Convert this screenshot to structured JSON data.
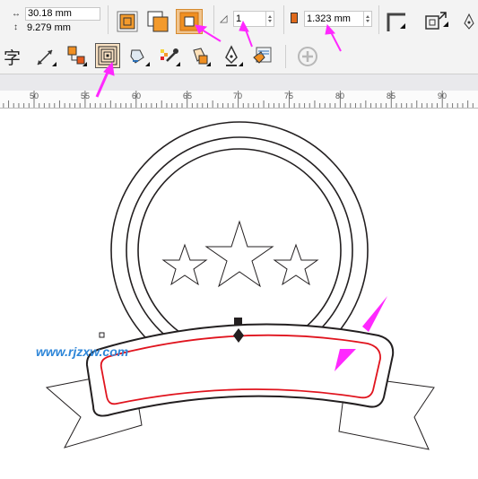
{
  "property_bar": {
    "width_value": "30.18 mm",
    "height_value": "9.279 mm",
    "steps_value": "1",
    "offset_value": "1.323 mm",
    "contour_modes": [
      "contour-to-center",
      "inside-contour",
      "outside-contour"
    ],
    "active_mode": "outside-contour"
  },
  "toolbox": {
    "tools": [
      "text-tool-icon",
      "dimension-tool-icon",
      "connector-tool-icon",
      "contour-tool-icon",
      "fill-tool-icon",
      "eyedropper-tool-icon",
      "interactive-fill-icon",
      "pen-outline-icon",
      "smart-fill-icon",
      "add-tool-icon"
    ],
    "active_tool": "contour-tool-icon",
    "text_glyph": "字"
  },
  "ruler": {
    "labels": [
      "50",
      "55",
      "60",
      "65",
      "70",
      "75",
      "80",
      "85",
      "90"
    ]
  },
  "canvas": {
    "outline_color": "#231f20",
    "contour_color": "#e0141e",
    "arrow_color": "#ff28ff"
  },
  "watermark": "www.rjzxw.com"
}
